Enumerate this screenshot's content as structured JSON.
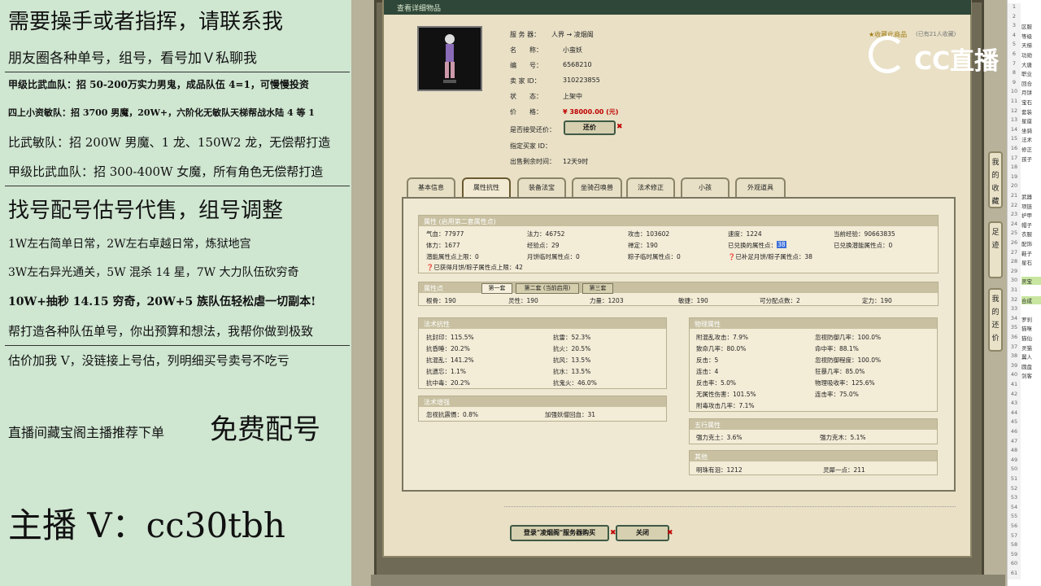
{
  "promo": {
    "line1": "需要操手或者指挥，请联系我",
    "line2": "朋友圈各种单号，组号，看号加Ｖ私聊我",
    "line3": "甲级比武血队：招 50-200万实力男鬼，成品队伍 4=1，可慢慢投资",
    "line4": "四上小资敏队：招 3700 男魔，20W+，六阶化无敏队天梯帮战水陆 4 等 1",
    "line5": "比武敏队：招 200W 男魔、1 龙、150W2 龙，无偿帮打造",
    "line6": "甲级比武血队：招 300-400W 女魔，所有角色无偿帮打造",
    "line7": "找号配号估号代售，组号调整",
    "line8": "1W左右简单日常，2W左右卓越日常，炼狱地宫",
    "line9": "3W左右异光通关，5W 混杀 14 星，7W 大力队伍砍穷奇",
    "line10": "10W+抽秒 14.15 穷奇，20W+5 族队伍轻松虐一切副本!",
    "line11": "帮打造各种队伍单号，你出预算和想法，我帮你做到极致",
    "line12": "估价加我 V，没链接上号估，列明细买号卖号不吃亏",
    "line13a": "直播间藏宝阁主播推荐下单",
    "line13b": "免费配号",
    "line14": "主播 V：cc30tbh"
  },
  "window": {
    "title": "查看详细物品",
    "info": {
      "server_label": "服 务 器：",
      "server_value": "人界 → 凌烟阁",
      "name_label": "名　　称：",
      "name_value": "小蛮妖",
      "id_label": "编　　号：",
      "id_value": "6568210",
      "seller_label": "卖 家 ID：",
      "seller_value": "310223855",
      "status_label": "状　　态：",
      "status_value": "上架中",
      "price_label": "价　　格：",
      "price_value": "¥ 38000.00 (元)",
      "bargain_label": "是否接受还价：",
      "bargain_button": "还价",
      "buyer_label": "指定买家 ID：",
      "buyer_value": "",
      "remain_label": "出售剩余时间：",
      "remain_value": "12天9时",
      "favorite_text": "收藏此商品",
      "favorite_count": "(已有21人收藏)"
    },
    "tabs": [
      "基本信息",
      "属性抗性",
      "装备法宝",
      "坐骑召唤兽",
      "法术修正",
      "小孩",
      "外观道具"
    ],
    "side_tabs": [
      "我的收藏",
      "足迹",
      "我的还价"
    ],
    "attr": {
      "header": "属性 (启用第二套属性点)",
      "r1": [
        "气血：77977",
        "法力：46752",
        "攻击：103602",
        "速度：1224",
        "当前经验：90663835"
      ],
      "r2": [
        "体力：1677",
        "经验点：29",
        "禅定：190",
        "已兑换的属性点：",
        "已兑换潜能属性点：0"
      ],
      "r2_highlight": "38",
      "r3": [
        "潜能属性点上限：0",
        "月饼临时属性点：0",
        "粽子临时属性点：0",
        "已补足月饼/粽子属性点：38"
      ],
      "r4": "已获得月饼/粽子属性点上限：42"
    },
    "points": {
      "header": "属性点",
      "subtabs": [
        "第一套",
        "第二套 (当前启用)",
        "第三套"
      ],
      "row": [
        "根骨：190",
        "灵性：190",
        "力量：1203",
        "敏捷：190",
        "可分配点数：2",
        "定力：190"
      ]
    },
    "resist": {
      "header": "法术抗性",
      "rows": [
        [
          "抗封印：115.5%",
          "抗雷：52.3%"
        ],
        [
          "抗昏睡：20.2%",
          "抗火：20.5%"
        ],
        [
          "抗混乱：141.2%",
          "抗风：13.5%"
        ],
        [
          "抗遗忘：1.1%",
          "抗水：13.5%"
        ],
        [
          "抗中毒：20.2%",
          "抗鬼火：46.0%"
        ]
      ]
    },
    "enhance": {
      "header": "法术增强",
      "row": [
        "忽视抗震慑：0.8%",
        "加强妖僧回血：31"
      ]
    },
    "physical": {
      "header": "物理属性",
      "rows": [
        [
          "附混乱攻击：7.9%",
          "忽视防御几率：100.0%"
        ],
        [
          "致命几率：80.0%",
          "命中率：88.1%"
        ],
        [
          "反击：5",
          "忽视防御程度：100.0%"
        ],
        [
          "连击：4",
          "狂暴几率：85.0%"
        ],
        [
          "反击率：5.0%",
          "物理吸收率：125.6%"
        ],
        [
          "无属性伤害：101.5%",
          "连击率：75.0%"
        ],
        [
          "附毒攻击几率：7.1%",
          ""
        ]
      ]
    },
    "element": {
      "header": "五行属性",
      "row": [
        "强力克土：3.6%",
        "强力克木：5.1%"
      ]
    },
    "other": {
      "header": "其他",
      "row": [
        "明珠有泪：1212",
        "灵犀一点：211"
      ]
    },
    "buy_button": "登录\"凌烟阁\"服务器购买",
    "close_button": "关闭"
  },
  "logo": {
    "text": "CC直播"
  },
  "sheet": {
    "rows": [
      {
        "n": "1",
        "v": ""
      },
      {
        "n": "2",
        "v": ""
      },
      {
        "n": "3",
        "v": "区服"
      },
      {
        "n": "4",
        "v": "等级"
      },
      {
        "n": "5",
        "v": "天梯"
      },
      {
        "n": "6",
        "v": "功勋"
      },
      {
        "n": "7",
        "v": "大唐"
      },
      {
        "n": "8",
        "v": "职业"
      },
      {
        "n": "9",
        "v": "回合"
      },
      {
        "n": "10",
        "v": "月饼"
      },
      {
        "n": "11",
        "v": "宝石"
      },
      {
        "n": "12",
        "v": "套装"
      },
      {
        "n": "13",
        "v": "星座"
      },
      {
        "n": "14",
        "v": "坐骑"
      },
      {
        "n": "15",
        "v": "法术"
      },
      {
        "n": "16",
        "v": "修正"
      },
      {
        "n": "17",
        "v": "孩子"
      },
      {
        "n": "18",
        "v": ""
      },
      {
        "n": "19",
        "v": ""
      },
      {
        "n": "20",
        "v": ""
      },
      {
        "n": "21",
        "v": "武器"
      },
      {
        "n": "22",
        "v": "项链"
      },
      {
        "n": "23",
        "v": "护甲"
      },
      {
        "n": "24",
        "v": "帽子"
      },
      {
        "n": "25",
        "v": "衣服"
      },
      {
        "n": "26",
        "v": "配饰"
      },
      {
        "n": "27",
        "v": "鞋子"
      },
      {
        "n": "28",
        "v": "星石"
      },
      {
        "n": "29",
        "v": ""
      },
      {
        "n": "30",
        "v": "灵宝"
      },
      {
        "n": "31",
        "v": ""
      },
      {
        "n": "32",
        "v": "合成"
      },
      {
        "n": "33",
        "v": ""
      },
      {
        "n": "34",
        "v": "罗刹"
      },
      {
        "n": "35",
        "v": "猫咪"
      },
      {
        "n": "36",
        "v": "猫仙"
      },
      {
        "n": "37",
        "v": "灵猫"
      },
      {
        "n": "38",
        "v": "翼人"
      },
      {
        "n": "39",
        "v": "圆盘"
      },
      {
        "n": "40",
        "v": "剑客"
      },
      {
        "n": "41",
        "v": ""
      },
      {
        "n": "42",
        "v": ""
      },
      {
        "n": "43",
        "v": ""
      },
      {
        "n": "44",
        "v": ""
      },
      {
        "n": "45",
        "v": ""
      },
      {
        "n": "46",
        "v": ""
      },
      {
        "n": "47",
        "v": ""
      },
      {
        "n": "48",
        "v": ""
      },
      {
        "n": "49",
        "v": ""
      },
      {
        "n": "50",
        "v": ""
      },
      {
        "n": "51",
        "v": ""
      },
      {
        "n": "52",
        "v": ""
      },
      {
        "n": "53",
        "v": ""
      },
      {
        "n": "54",
        "v": ""
      },
      {
        "n": "55",
        "v": ""
      },
      {
        "n": "56",
        "v": ""
      },
      {
        "n": "57",
        "v": ""
      },
      {
        "n": "58",
        "v": ""
      },
      {
        "n": "59",
        "v": ""
      },
      {
        "n": "60",
        "v": ""
      },
      {
        "n": "61",
        "v": ""
      }
    ]
  },
  "colors": {
    "accent_red": "#c00000",
    "title_green": "#2f4738"
  }
}
